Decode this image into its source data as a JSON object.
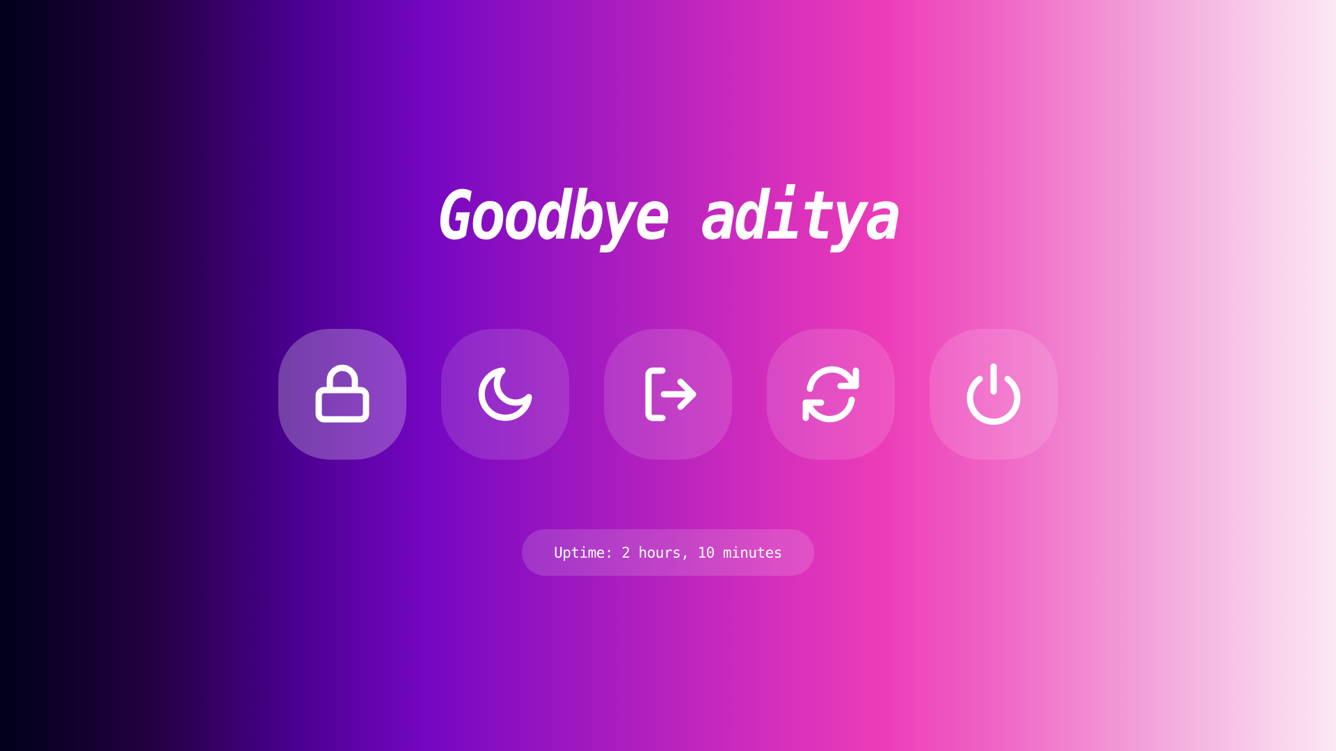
{
  "greeting": "Goodbye aditya",
  "actions": [
    {
      "id": "lock",
      "icon": "lock-icon",
      "state": "active"
    },
    {
      "id": "suspend",
      "icon": "moon-icon",
      "state": "idle"
    },
    {
      "id": "logout",
      "icon": "logout-icon",
      "state": "idle"
    },
    {
      "id": "reboot",
      "icon": "refresh-icon",
      "state": "idle"
    },
    {
      "id": "shutdown",
      "icon": "power-icon",
      "state": "idle"
    }
  ],
  "uptime": "Uptime: 2 hours, 10 minutes",
  "colors": {
    "gradient_start": "#000019",
    "gradient_mid": "#7506c2",
    "gradient_accent": "#ec3cb8",
    "gradient_end": "#fce8f4",
    "icon": "#ffffff"
  }
}
